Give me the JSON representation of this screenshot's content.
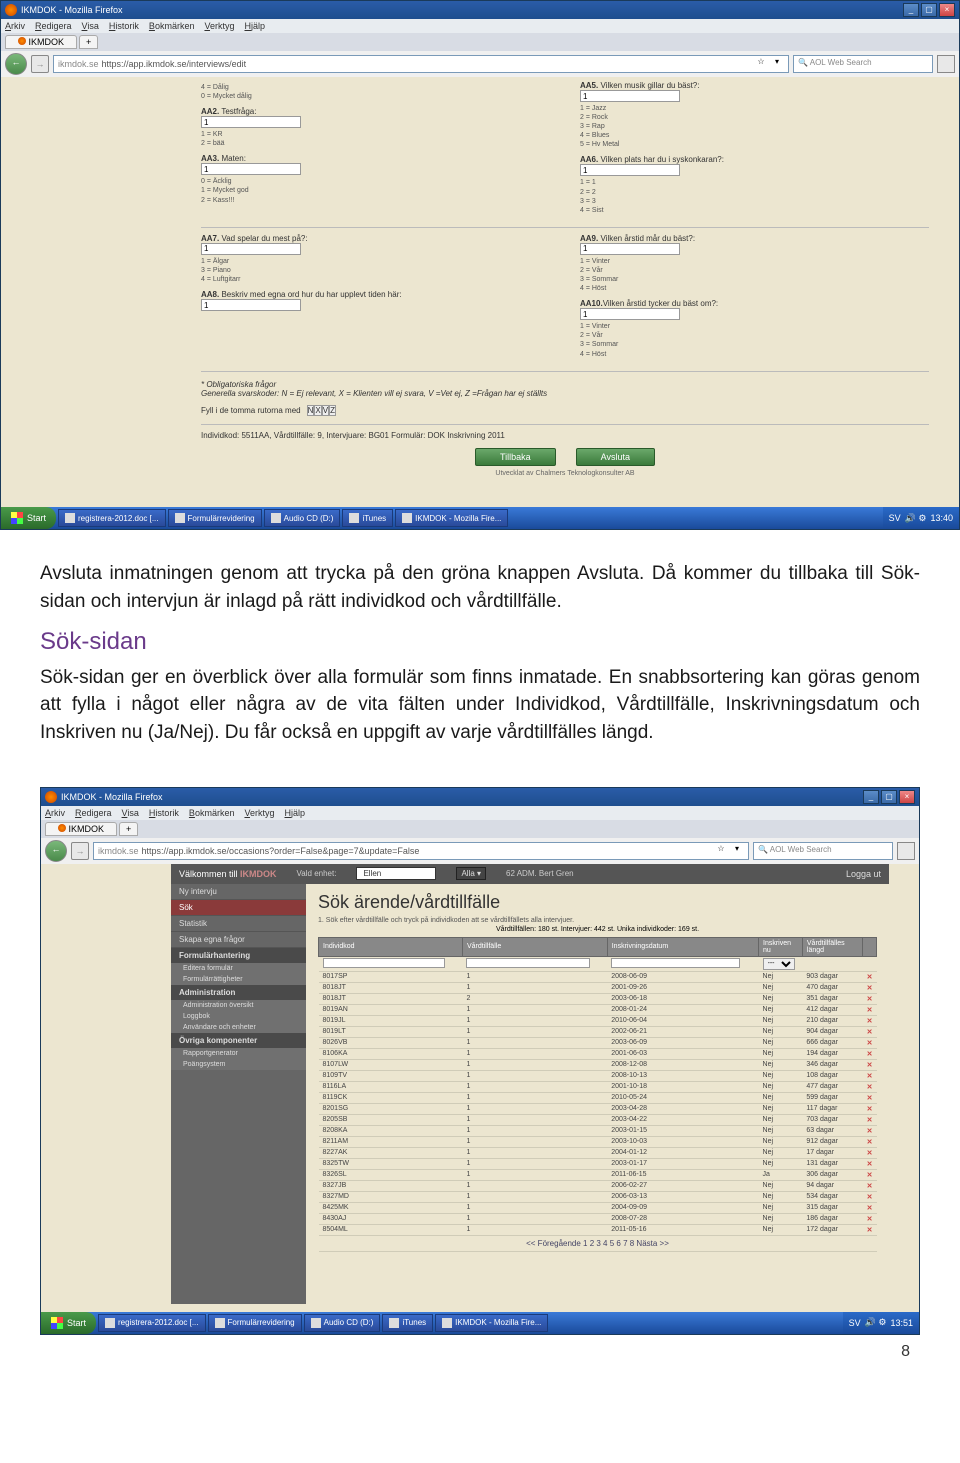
{
  "browser": {
    "title": "IKMDOK - Mozilla Firefox",
    "menu": [
      "Arkiv",
      "Redigera",
      "Visa",
      "Historik",
      "Bokmärken",
      "Verktyg",
      "Hjälp"
    ],
    "tab": "IKMDOK",
    "url1": "https://app.ikmdok.se/interviews/edit",
    "url2": "https://app.ikmdok.se/occasions?order=False&page=7&update=False",
    "search_placeholder": "AOL Web Search"
  },
  "form1": {
    "aa1_opts": "4 = Dålig\n0 = Mycket dålig",
    "aa2_label": "Testfråga:",
    "aa2_val": "1",
    "aa2_opts": "1 = KR\n2 = bää",
    "aa3_label": "Maten:",
    "aa3_val": "1",
    "aa3_opts": "0 = Äcklig\n1 = Mycket god\n2 = Kass!!!",
    "aa5_label": "Vilken musik gillar du bäst?:",
    "aa5_val": "1",
    "aa5_opts": "1 = Jazz\n2 = Rock\n3 = Rap\n4 = Blues\n5 = Hv Metal",
    "aa6_label": "Vilken plats har du i syskonkaran?:",
    "aa6_val": "1",
    "aa6_opts": "1 = 1\n2 = 2\n3 = 3\n4 = Sist",
    "aa7_label": "Vad spelar du mest på?:",
    "aa7_val": "1",
    "aa7_opts": "1 = Älgar\n3 = Piano\n4 = Luftgitarr",
    "aa8_label": "Beskriv med egna ord hur du har upplevt tiden här:",
    "aa8_val": "1",
    "aa9_label": "Vilken årstid mår du bäst?:",
    "aa9_val": "1",
    "aa9_opts": "1 = Vinter\n2 = Vår\n3 = Sommar\n4 = Höst",
    "aa10_label": "Vilken årstid tycker du bäst om?:",
    "aa10_val": "1",
    "aa10_opts": "1 = Vinter\n2 = Vår\n3 = Sommar\n4 = Höst",
    "oblig": "* Obligatoriska frågor",
    "codes": "Generella svarskoder: N = Ej relevant, X = Klienten vill ej svara, V =Vet ej, Z =Frågan har ej ställts",
    "fill_label": "Fyll i de tomma rutorna med",
    "fill_btns": [
      "N",
      "X",
      "V",
      "Z"
    ],
    "info": "Individkod: 5511AA, Vårdtillfälle: 9, Intervjuare: BG01 Formulär: DOK Inskrivning 2011",
    "btn_back": "Tillbaka",
    "btn_finish": "Avsluta",
    "credit": "Utvecklat av Chalmers Teknologkonsulter AB"
  },
  "taskbar": {
    "start": "Start",
    "items1": [
      "registrera-2012.doc [...",
      "Formulärrevidering",
      "Audio CD (D:)",
      "iTunes",
      "IKMDOK - Mozilla Fire..."
    ],
    "tray1": {
      "lang": "SV",
      "time": "13:40"
    },
    "items2": [
      "registrera-2012.doc [...",
      "Formulärrevidering",
      "Audio CD (D:)",
      "iTunes",
      "IKMDOK - Mozilla Fire..."
    ],
    "tray2": {
      "lang": "SV",
      "time": "13:51"
    }
  },
  "doc": {
    "para1": "Avsluta inmatningen genom att trycka på den gröna knappen Avsluta. Då kommer du tillbaka till Sök-sidan och intervjun är inlagd på rätt individkod och vårdtillfälle.",
    "heading": "Sök-sidan",
    "para2": "Sök-sidan ger en överblick över alla formulär som finns inmatade. En snabbsortering kan göras genom att fylla i något eller några av de vita fälten under Individkod, Vårdtillfälle, Inskrivningsdatum och Inskriven nu (Ja/Nej). Du får också en uppgift av varje vårdtillfälles längd.",
    "page_num": "8"
  },
  "ss2": {
    "welcome": "Välkommen till",
    "brand": "IKMDOK",
    "unit_label": "Vald enhet:",
    "unit_val": "Ellen",
    "select_val": "Alla",
    "user": "62 ADM. Bert Gren",
    "logout": "Logga ut",
    "sidebar": {
      "items": [
        "Ny intervju",
        "Sök",
        "Statistik",
        "Skapa egna frågor"
      ],
      "h_form": "Formulärhantering",
      "form_sub": [
        "Editera formulär",
        "Formulärrättigheter"
      ],
      "h_admin": "Administration",
      "admin_sub": [
        "Administration översikt",
        "Loggbok",
        "Användare och enheter"
      ],
      "h_other": "Övriga komponenter",
      "other_sub": [
        "Rapportgenerator",
        "Poängsystem"
      ]
    },
    "title": "Sök ärende/vårdtillfälle",
    "instr": "1. Sök efter vårdtillfälle och tryck på individkoden att se vårdtillfällets alla intervjuer.",
    "counts": "Vårdtillfällen: 180 st. Intervjuer: 442 st. Unika individkoder: 169 st.",
    "headers": [
      "Individkod",
      "Vårdtillfälle",
      "Inskrivningsdatum",
      "Inskriven nu",
      "Vårdtillfälles längd",
      ""
    ],
    "filter_select": "---",
    "rows": [
      [
        "8017SP",
        "1",
        "2008-06-09",
        "Nej",
        "903 dagar"
      ],
      [
        "8018JT",
        "1",
        "2001-09-26",
        "Nej",
        "470 dagar"
      ],
      [
        "8018JT",
        "2",
        "2003-06-18",
        "Nej",
        "351 dagar"
      ],
      [
        "8019AN",
        "1",
        "2008-01-24",
        "Nej",
        "412 dagar"
      ],
      [
        "8019JL",
        "1",
        "2010-06-04",
        "Nej",
        "210 dagar"
      ],
      [
        "8019LT",
        "1",
        "2002-06-21",
        "Nej",
        "904 dagar"
      ],
      [
        "8026VB",
        "1",
        "2003-06-09",
        "Nej",
        "666 dagar"
      ],
      [
        "8106KA",
        "1",
        "2001-06-03",
        "Nej",
        "194 dagar"
      ],
      [
        "8107LW",
        "1",
        "2008-12-08",
        "Nej",
        "346 dagar"
      ],
      [
        "8109TV",
        "1",
        "2008-10-13",
        "Nej",
        "108 dagar"
      ],
      [
        "8116LA",
        "1",
        "2001-10-18",
        "Nej",
        "477 dagar"
      ],
      [
        "8119CK",
        "1",
        "2010-05-24",
        "Nej",
        "599 dagar"
      ],
      [
        "8201SG",
        "1",
        "2003-04-28",
        "Nej",
        "117 dagar"
      ],
      [
        "8205SB",
        "1",
        "2003-04-22",
        "Nej",
        "703 dagar"
      ],
      [
        "8208KA",
        "1",
        "2003-01-15",
        "Nej",
        "63 dagar"
      ],
      [
        "8211AM",
        "1",
        "2003-10-03",
        "Nej",
        "912 dagar"
      ],
      [
        "8227AK",
        "1",
        "2004-01-12",
        "Nej",
        "17 dagar"
      ],
      [
        "8325TW",
        "1",
        "2003-01-17",
        "Nej",
        "131 dagar"
      ],
      [
        "8326SL",
        "1",
        "2011-06-15",
        "Ja",
        "306 dagar"
      ],
      [
        "8327JB",
        "1",
        "2006-02-27",
        "Nej",
        "94 dagar"
      ],
      [
        "8327MD",
        "1",
        "2006-03-13",
        "Nej",
        "534 dagar"
      ],
      [
        "8425MK",
        "1",
        "2004-09-09",
        "Nej",
        "315 dagar"
      ],
      [
        "8430AJ",
        "1",
        "2008-07-28",
        "Nej",
        "186 dagar"
      ],
      [
        "8504ML",
        "1",
        "2011-05-16",
        "Nej",
        "172 dagar"
      ]
    ],
    "pager": "<< Föregående 1 2 3 4 5 6 7 8 Nästa >>"
  }
}
